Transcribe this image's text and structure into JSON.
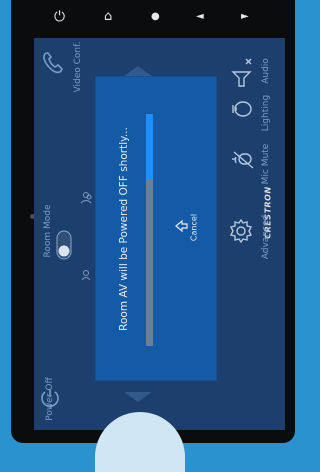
{
  "hardware_buttons": [
    {
      "name": "power-icon",
      "glyph": "⏻"
    },
    {
      "name": "home-icon",
      "glyph": "⌂"
    },
    {
      "name": "lights-icon",
      "glyph": "●"
    },
    {
      "name": "volume-down-icon",
      "glyph": "◄"
    },
    {
      "name": "volume-up-icon",
      "glyph": "►"
    }
  ],
  "room_mode": {
    "label": "Room Mode",
    "state": "on"
  },
  "sources": {
    "video_conf": "Video Conf."
  },
  "right_menu": {
    "audio": "Audio",
    "lighting": "Lighting",
    "mic_mute": "Mic Mute",
    "advanced": "Advanced"
  },
  "brand": "CRESTRON",
  "power_off": "Power Off",
  "dialog": {
    "message": "Room AV will be Powered OFF shortly...",
    "progress": 0.28,
    "cancel_label": "Cancel"
  },
  "colors": {
    "screen_bg": "#1c3f6e",
    "dialog_bg": "#155aa6",
    "progress_fill": "#1e8fff",
    "progress_track": "#6c7f95"
  }
}
